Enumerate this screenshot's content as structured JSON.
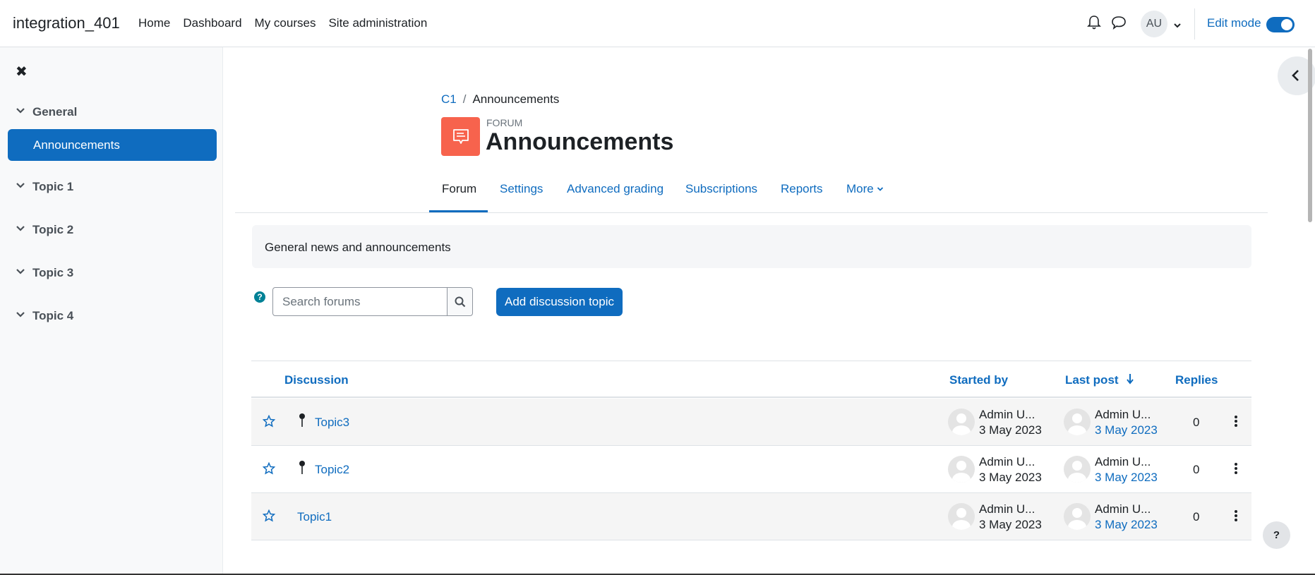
{
  "site": {
    "brand": "integration_401"
  },
  "primary_nav": [
    "Home",
    "Dashboard",
    "My courses",
    "Site administration"
  ],
  "user_menu": {
    "initials": "AU"
  },
  "edit_mode": {
    "label": "Edit mode",
    "enabled": true
  },
  "drawer": {
    "sections": [
      {
        "label": "General"
      },
      {
        "label": "Topic 1"
      },
      {
        "label": "Topic 2"
      },
      {
        "label": "Topic 3"
      },
      {
        "label": "Topic 4"
      }
    ],
    "active_item": "Announcements"
  },
  "breadcrumb": {
    "course": "C1",
    "current": "Announcements"
  },
  "header": {
    "mod_type": "FORUM",
    "title": "Announcements"
  },
  "tabs": [
    "Forum",
    "Settings",
    "Advanced grading",
    "Subscriptions",
    "Reports",
    "More"
  ],
  "active_tab": "Forum",
  "intro": "General news and announcements",
  "search": {
    "placeholder": "Search forums"
  },
  "add_button": "Add discussion topic",
  "table": {
    "columns": [
      "Discussion",
      "Started by",
      "Last post",
      "Replies"
    ],
    "rows": [
      {
        "topic": "Topic3",
        "pinned": true,
        "started_by": "Admin U...",
        "started_date": "3 May 2023",
        "last_by": "Admin U...",
        "last_date": "3 May 2023",
        "replies": "0"
      },
      {
        "topic": "Topic2",
        "pinned": true,
        "started_by": "Admin U...",
        "started_date": "3 May 2023",
        "last_by": "Admin U...",
        "last_date": "3 May 2023",
        "replies": "0"
      },
      {
        "topic": "Topic1",
        "pinned": false,
        "started_by": "Admin U...",
        "started_date": "3 May 2023",
        "last_by": "Admin U...",
        "last_date": "3 May 2023",
        "replies": "0"
      }
    ]
  },
  "help_fab": "?",
  "colors": {
    "primary": "#0f6cbf",
    "forum_icon": "#f7634d",
    "help": "#008196"
  }
}
